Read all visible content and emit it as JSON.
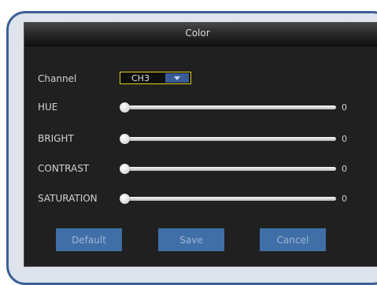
{
  "dialog": {
    "title": "Color"
  },
  "channel": {
    "label": "Channel",
    "value": "CH3"
  },
  "sliders": [
    {
      "label": "HUE",
      "value": "0"
    },
    {
      "label": "BRIGHT",
      "value": "0"
    },
    {
      "label": "CONTRAST",
      "value": "0"
    },
    {
      "label": "SATURATION",
      "value": "0"
    }
  ],
  "buttons": {
    "default": "Default",
    "save": "Save",
    "cancel": "Cancel"
  },
  "colors": {
    "frame": "#3d5f97",
    "button": "#3f6fa6",
    "select_border": "#e2d31a"
  },
  "icons": {
    "dropdown": "chevron-down-icon"
  }
}
